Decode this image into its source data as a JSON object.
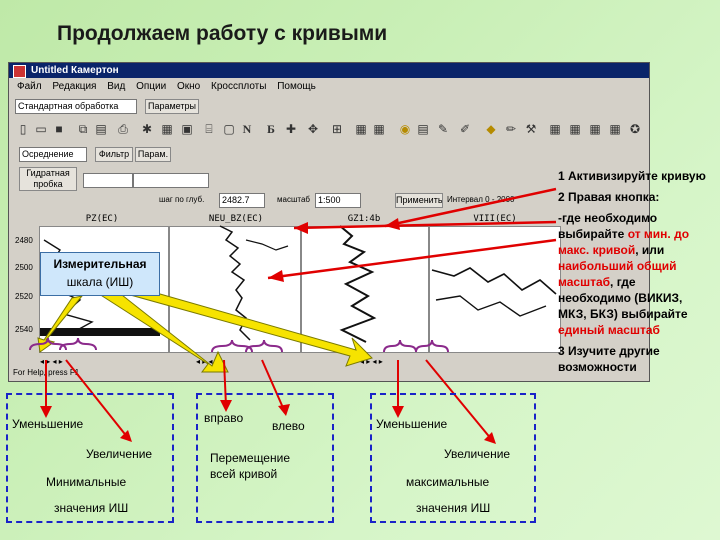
{
  "slide": {
    "title": "Продолжаем работу с кривыми"
  },
  "window": {
    "title": "Untitled  Камертон"
  },
  "menu": [
    "Файл",
    "Редакция",
    "Вид",
    "Опции",
    "Окно",
    "Кроссплоты",
    "Помощь"
  ],
  "toolbar": {
    "mode_select": "Стандартная обработка",
    "params_button": "Параметры",
    "averaging_select": "Осреднение",
    "filter_button": "Фильтр",
    "param_button": "Парам.",
    "hydro_label": "Гидратная пробка",
    "step_label": "шаг по глуб.",
    "step_value": "2482.7",
    "scale_label": "масштаб",
    "scale_value": "1:500",
    "apply_button": "Применить",
    "interval_label": "Интервал 0 - 2000"
  },
  "depth_ticks": [
    "2480",
    "2500",
    "2520",
    "2540"
  ],
  "tracks": [
    {
      "header": "PZ(ЕС)"
    },
    {
      "header": "NEU_BZ(ЕС)"
    },
    {
      "header": "GZ1:4b"
    },
    {
      "header": "VIII(ЕС)"
    }
  ],
  "status_text": "For Help, press F1",
  "callout": {
    "line1": "Измерительная",
    "line2": "шкала (ИШ)"
  },
  "left_box": {
    "decrease": "Уменьшение",
    "increase": "Увеличение",
    "minimal": "Минимальные",
    "values": "значения ИШ"
  },
  "middle_box": {
    "right": "вправо",
    "left": "влево",
    "move_line1": "Перемещение",
    "move_line2": "всей кривой"
  },
  "right_box": {
    "decrease": "Уменьшение",
    "increase": "Увеличение",
    "maximal": "максимальные",
    "values": "значения ИШ"
  },
  "info": {
    "step1": "1 Активизируйте кривую",
    "step2": "2 Правая кнопка:",
    "step2_text_a": "-где необходимо выбирайте ",
    "step2_red_a": "от мин. до макс. кривой",
    "step2_text_b": ", или ",
    "step2_red_b": "наибольший общий масштаб",
    "step2_text_c": ", где необходимо (ВИКИЗ, МКЗ, БКЗ) выбирайте ",
    "step2_red_c": "единый масштаб",
    "step3": "3 Изучите другие возможности"
  },
  "colors": {
    "accent_red": "#e00000",
    "arrow_yellow": "#f6e300",
    "box_blue": "#1a23c8"
  }
}
